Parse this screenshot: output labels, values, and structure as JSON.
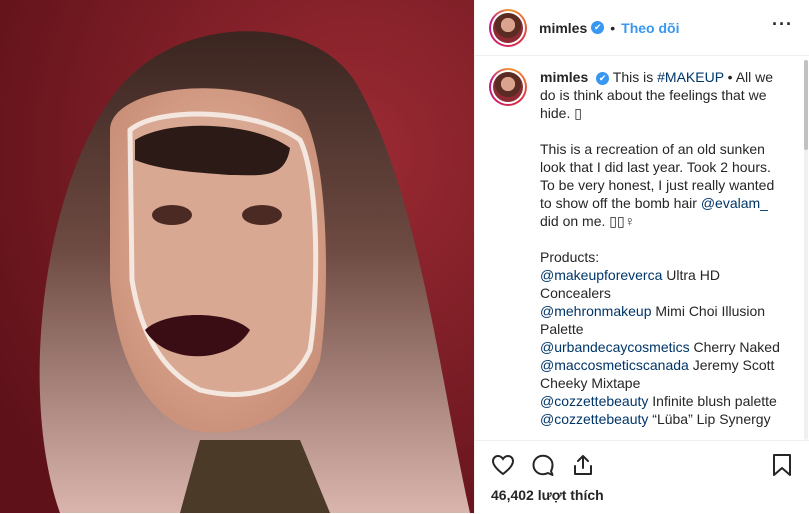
{
  "header": {
    "username": "mimles",
    "verified_mark": "✔",
    "separator": "•",
    "follow_label": "Theo dõi",
    "more_label": "···"
  },
  "caption": {
    "username": "mimles",
    "line1_pre": "This is ",
    "line1_tag": "#MAKEUP",
    "line1_post": " • All we do is think about the feelings that we hide. ",
    "line1_emoji": "▯",
    "para2_pre": "This is a recreation of an old sunken look that I did last year. Took 2 hours. To be very honest, I just really wanted to show off the bomb hair ",
    "para2_mention": "@evalam_",
    "para2_post": " did on me. ",
    "para2_emoji": "▯▯♀",
    "products_label": "Products:",
    "products": [
      {
        "mention": "@makeupforeverca",
        "text": " Ultra HD Concealers"
      },
      {
        "mention": "@mehronmakeup",
        "text": " Mimi Choi Illusion Palette"
      },
      {
        "mention": "@urbandecaycosmetics",
        "text": " Cherry Naked"
      },
      {
        "mention": "@maccosmeticscanada",
        "text": " Jeremy Scott Cheeky Mixtape"
      },
      {
        "mention": "@cozzettebeauty",
        "text": " Infinite blush palette"
      },
      {
        "mention": "@cozzettebeauty",
        "text": " “Lüba” Lip Synergy"
      }
    ]
  },
  "actions": {
    "icons": [
      "heart-icon",
      "comment-icon",
      "share-icon",
      "bookmark-icon"
    ],
    "likes_text": "46,402 lượt thích"
  },
  "colors": {
    "link": "#003569",
    "follow": "#3897f0",
    "photo_bg": "#7a1a24"
  }
}
